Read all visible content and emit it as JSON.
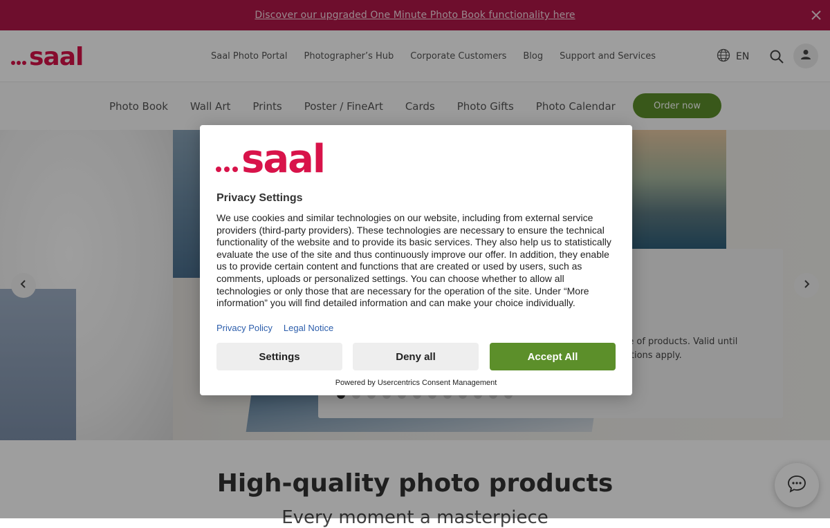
{
  "promo": {
    "text": "Discover our upgraded One Minute Photo Book functionality here"
  },
  "header": {
    "nav": [
      "Saal Photo Portal",
      "Photographer’s Hub",
      "Corporate Customers",
      "Blog",
      "Support and Services"
    ],
    "language": "EN"
  },
  "category_nav": {
    "items": [
      "Photo Book",
      "Wall Art",
      "Prints",
      "Poster / FineArt",
      "Cards",
      "Photo Gifts",
      "Photo Calendar"
    ],
    "order_button": "Order now"
  },
  "hero": {
    "partial_text_line1": "ge of products. Valid until",
    "partial_text_line2": "ditions apply.",
    "slide_count": 12,
    "active_slide": 1
  },
  "section": {
    "title": "High-quality photo products",
    "subtitle": "Every moment a masterpiece"
  },
  "consent": {
    "title": "Privacy Settings",
    "body": "We use cookies and similar technologies on our website, including from external service providers (third-party providers). These technologies are necessary to ensure the technical functionality of the website and to provide its basic services. They also help us to statistically evaluate the use of the site and thus continuously improve our offer. In addition, they enable us to provide certain content and functions that are created or used by users, such as comments, uploads or personalized settings. You can choose whether to allow all technologies or only those that are necessary for the operation of the site. Under “More information” you will find detailed information and can make your choice individually.",
    "links": [
      "Privacy Policy",
      "Legal Notice"
    ],
    "buttons": {
      "settings": "Settings",
      "deny": "Deny all",
      "accept": "Accept All"
    },
    "powered_by": "Powered by Usercentrics Consent Management"
  },
  "colors": {
    "brand": "#d8134a",
    "promo_bg": "#b2174a",
    "accent_green": "#5c8f2a",
    "link_blue": "#2b5dab"
  },
  "icons": [
    "close-icon",
    "globe-icon",
    "search-icon",
    "user-icon",
    "chevron-left-icon",
    "chevron-right-icon",
    "chat-icon"
  ]
}
